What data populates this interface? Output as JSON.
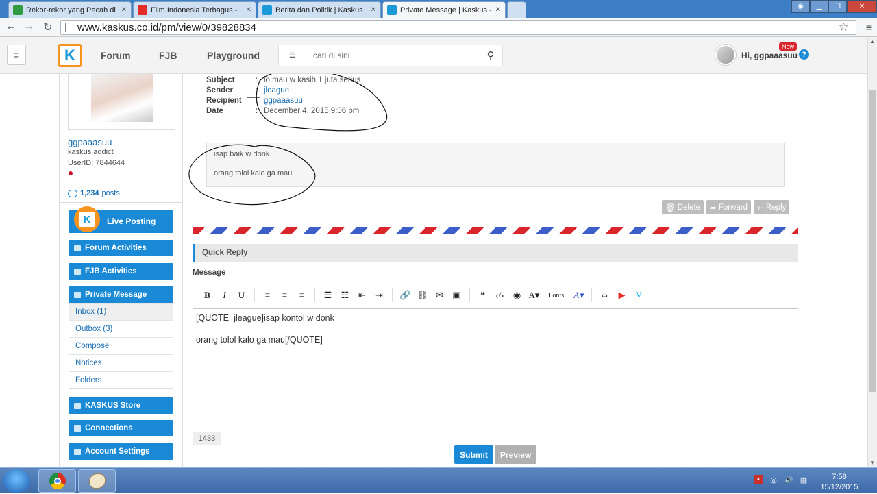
{
  "browser": {
    "tabs": [
      {
        "title": "Rekor-rekor yang Pecah di",
        "color": "#2e9b3e"
      },
      {
        "title": "Film Indonesia Terbagus -",
        "color": "#e52d27"
      },
      {
        "title": "Berita dan Politik | Kaskus",
        "color": "#1a9ad6"
      },
      {
        "title": "Private Message | Kaskus -",
        "color": "#1a9ad6"
      }
    ],
    "url": "www.kaskus.co.id/pm/view/0/39828834"
  },
  "header": {
    "nav": [
      "Forum",
      "FJB",
      "Playground"
    ],
    "search_placeholder": "cari di sini",
    "greeting": "Hi, ggpaaasuu",
    "new_badge": "New",
    "help": "?"
  },
  "sidebar": {
    "username": "ggpaaasuu",
    "rank": "kaskus addict",
    "user_id": "UserID: 7844644",
    "posts_count": "1,234",
    "posts_label": "posts",
    "live_posting": "Live Posting",
    "forum_activities": "Forum Activities",
    "fjb_activities": "FJB Activities",
    "private_message": "Private Message",
    "pm_items": [
      "Inbox (1)",
      "Outbox (3)",
      "Compose",
      "Notices",
      "Folders"
    ],
    "store": "KASKUS Store",
    "connections": "Connections",
    "account_settings": "Account Settings"
  },
  "message": {
    "subject_label": "Subject",
    "subject": "lo mau w kasih 1 juta serius",
    "sender_label": "Sender",
    "sender": "jleague",
    "recipient_label": "Recipient",
    "recipient": "ggpaaasuu",
    "date_label": "Date",
    "date": "December 4, 2015 9:06 pm",
    "colon": ":",
    "body_line1": "isap baik w donk.",
    "body_line2": "orang tolol kalo ga mau",
    "delete": "Delete",
    "forward": "Forward",
    "reply": "Reply"
  },
  "quick_reply": {
    "title": "Quick Reply",
    "message_label": "Message",
    "toolbar": {
      "bold": "B",
      "italic": "I",
      "underline": "U",
      "fonts": "Fonts"
    },
    "content_line1": "[QUOTE=jleague]isap kontol w donk",
    "content_line2": "orang tolol kalo ga mau[/QUOTE]",
    "char_count": "1433",
    "submit": "Submit",
    "preview": "Preview"
  },
  "taskbar": {
    "time": "7:58",
    "date": "15/12/2015"
  }
}
